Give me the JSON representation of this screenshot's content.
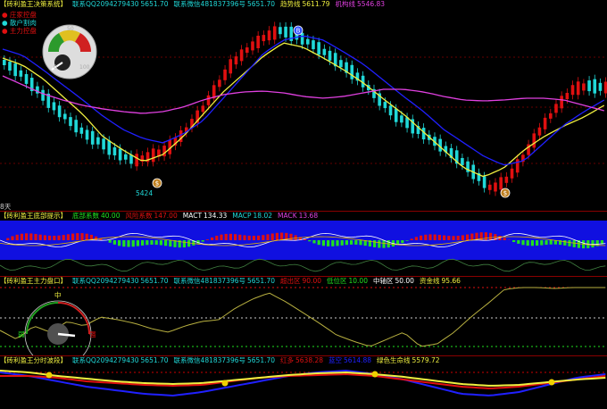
{
  "colors": {
    "red": "#e01010",
    "cyan": "#20d8d8",
    "yellow": "#f0f040",
    "blue": "#2020ff",
    "magenta": "#e040e0",
    "green": "#20e020",
    "white": "#ffffff",
    "gold": "#d4a020",
    "orange": "#ff8800"
  },
  "panel1": {
    "title": "【砖利盈王决策系统】",
    "items": [
      {
        "text": "联系QQ2094279430",
        "color": "#20d8d8"
      },
      {
        "text": "5651.70",
        "color": "#20d8d8"
      },
      {
        "text": "联系微信481837396号",
        "color": "#20d8d8"
      },
      {
        "text": "5651.70",
        "color": "#20d8d8"
      },
      {
        "text": "趋势线",
        "color": "#f0f040"
      },
      {
        "text": "5611.79",
        "color": "#f0f040"
      },
      {
        "text": "机构线",
        "color": "#e040e0"
      },
      {
        "text": "5546.83",
        "color": "#e040e0"
      }
    ],
    "left_labels": [
      {
        "text": "庄家控盘",
        "color": "#e01010"
      },
      {
        "text": "散户割肉",
        "color": "#20d8d8"
      },
      {
        "text": "主力控盘",
        "color": "#e01010"
      }
    ],
    "low_label": "5424",
    "gauge_value": "50",
    "gauge_min": "0",
    "gauge_max": "100",
    "badges": [
      "B",
      "$",
      "$"
    ],
    "corner_mark": "8天"
  },
  "panel2": {
    "title": "【砖利盈王底部提示】",
    "items": [
      {
        "text": "底部系数",
        "color": "#20e020"
      },
      {
        "text": "40.00",
        "color": "#20e020"
      },
      {
        "text": "风险系数",
        "color": "#e01010"
      },
      {
        "text": "147.00",
        "color": "#e01010"
      },
      {
        "text": "MACT",
        "color": "#ffffff"
      },
      {
        "text": "134.33",
        "color": "#ffffff"
      },
      {
        "text": "MACP",
        "color": "#20d8d8"
      },
      {
        "text": "18.02",
        "color": "#20d8d8"
      },
      {
        "text": "MACK",
        "color": "#e040e0"
      },
      {
        "text": "13.68",
        "color": "#e040e0"
      }
    ]
  },
  "panel3": {
    "title": "【砖利盈王主力盘口】",
    "items": [
      {
        "text": "联系QQ2094279430",
        "color": "#20d8d8"
      },
      {
        "text": "5651.70",
        "color": "#20d8d8"
      },
      {
        "text": "联系微信481837396号",
        "color": "#20d8d8"
      },
      {
        "text": "5651.70",
        "color": "#20d8d8"
      },
      {
        "text": "超出区",
        "color": "#e01010"
      },
      {
        "text": "90.00",
        "color": "#e01010"
      },
      {
        "text": "低位区",
        "color": "#20e020"
      },
      {
        "text": "10.00",
        "color": "#20e020"
      },
      {
        "text": "中轴区",
        "color": "#ffffff"
      },
      {
        "text": "50.00",
        "color": "#ffffff"
      },
      {
        "text": "资金线",
        "color": "#f0f040"
      },
      {
        "text": "95.66",
        "color": "#f0f040"
      }
    ],
    "gauge_mid": "中",
    "gauge_low": "弱",
    "gauge_high": "强"
  },
  "panel4": {
    "title": "【砖利盈王分时波段】",
    "items": [
      {
        "text": "联系QQ2094279430",
        "color": "#20d8d8"
      },
      {
        "text": "5651.70",
        "color": "#20d8d8"
      },
      {
        "text": "联系微信481837396号",
        "color": "#20d8d8"
      },
      {
        "text": "5651.70",
        "color": "#20d8d8"
      },
      {
        "text": "红多",
        "color": "#e01010"
      },
      {
        "text": "5638.28",
        "color": "#e01010"
      },
      {
        "text": "蓝空",
        "color": "#2020ff"
      },
      {
        "text": "5614.88",
        "color": "#2020ff"
      },
      {
        "text": "绿色生命线",
        "color": "#f0f040"
      },
      {
        "text": "5579.72",
        "color": "#f0f040"
      }
    ]
  }
}
